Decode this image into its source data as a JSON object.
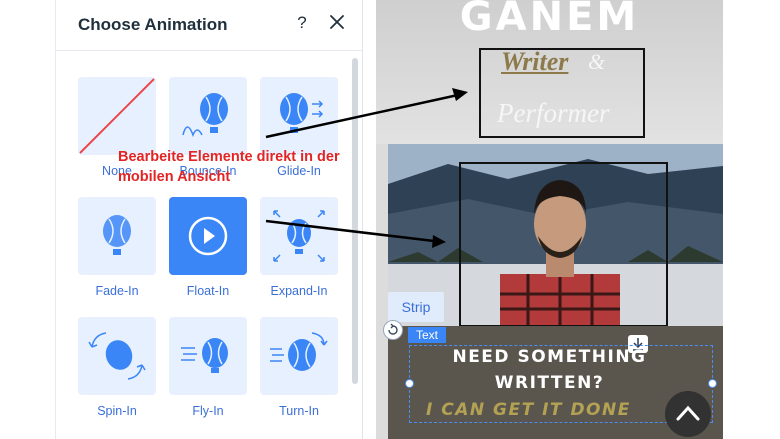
{
  "panel": {
    "title": "Choose Animation",
    "help_glyph": "?",
    "close_icon": "close-icon",
    "animations": [
      {
        "label": "None",
        "icon": "none-slash-icon",
        "selected": false
      },
      {
        "label": "Bounce-In",
        "icon": "balloon-bounce-icon",
        "selected": false
      },
      {
        "label": "Glide-In",
        "icon": "balloon-glide-icon",
        "selected": false
      },
      {
        "label": "Fade-In",
        "icon": "balloon-fade-icon",
        "selected": false
      },
      {
        "label": "Float-In",
        "icon": "play-icon",
        "selected": true
      },
      {
        "label": "Expand-In",
        "icon": "balloon-expand-icon",
        "selected": false
      },
      {
        "label": "Spin-In",
        "icon": "balloon-spin-icon",
        "selected": false
      },
      {
        "label": "Fly-In",
        "icon": "balloon-fly-icon",
        "selected": false
      },
      {
        "label": "Turn-In",
        "icon": "balloon-turn-icon",
        "selected": false
      }
    ]
  },
  "preview": {
    "name_banner": "GANEM",
    "role_writer": "Writer",
    "role_amp": "&",
    "role_performer": "Performer",
    "strip_tag": "Strip",
    "text_tag": "Text",
    "section_line1": "NEED SOMETHING",
    "section_line2": "WRITTEN?",
    "section_line3": "I CAN GET IT DONE",
    "scroll_top_icon": "chevron-up-icon"
  },
  "annotation": {
    "line1": "Bearbeite Elemente direkt in der",
    "line2": "mobilen Ansicht"
  },
  "colors": {
    "accent": "#3b86f7",
    "tile_bg": "#e7f0ff",
    "annotation_red": "#e32424",
    "gold_text": "#b3a154"
  }
}
